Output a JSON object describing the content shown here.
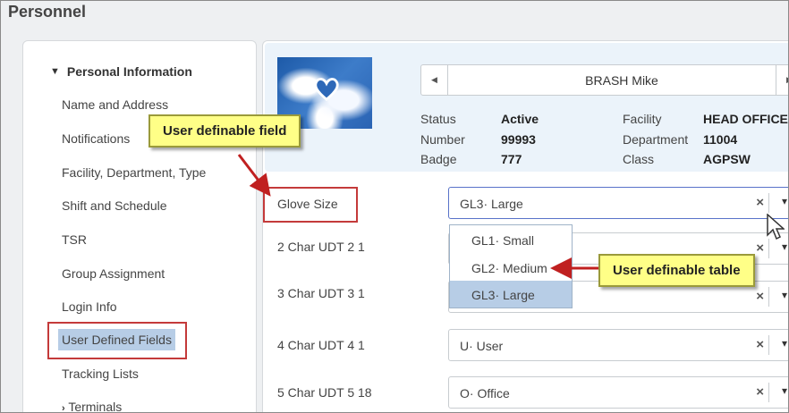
{
  "page": {
    "title": "Personnel"
  },
  "sidebar": {
    "section": "Personal Information",
    "items": [
      {
        "label": "Name and Address"
      },
      {
        "label": "Notifications"
      },
      {
        "label": "Facility, Department, Type"
      },
      {
        "label": "Shift and Schedule"
      },
      {
        "label": "TSR"
      },
      {
        "label": "Group Assignment"
      },
      {
        "label": "Login Info"
      },
      {
        "label": "User Defined Fields"
      },
      {
        "label": "Tracking Lists"
      },
      {
        "label": "Terminals"
      }
    ]
  },
  "header": {
    "name": "BRASH Mike",
    "status_label": "Status",
    "status_value": "Active",
    "number_label": "Number",
    "number_value": "99993",
    "badge_label": "Badge",
    "badge_value": "777",
    "facility_label": "Facility",
    "facility_value": "HEAD OFFICE",
    "department_label": "Department",
    "department_value": "11004",
    "class_label": "Class",
    "class_value": "AGPSW"
  },
  "fields": [
    {
      "label": "Glove Size",
      "value": "GL3· Large"
    },
    {
      "label": "2 Char UDT 2 1",
      "value": ""
    },
    {
      "label": "3 Char UDT 3 1",
      "value": ""
    },
    {
      "label": "4 Char UDT 4 1",
      "value": "U· User"
    },
    {
      "label": "5 Char UDT 5 18",
      "value": "O· Office"
    }
  ],
  "dropdown": {
    "options": [
      {
        "label": "GL1· Small"
      },
      {
        "label": "GL2· Medium"
      },
      {
        "label": "GL3· Large"
      }
    ],
    "selected": "GL3· Large"
  },
  "callouts": {
    "field": "User definable field",
    "table": "User definable table"
  },
  "icons": {
    "clear": "×",
    "caret": "⌄",
    "chevron_down": "⌄",
    "chevron_right": "›",
    "nav_left": "◀",
    "nav_right": "▶"
  },
  "colors": {
    "highlight_box": "#c43a3a",
    "callout_bg": "#ffff87",
    "selected_bg": "#b7cde6",
    "arrow": "#c02020"
  }
}
